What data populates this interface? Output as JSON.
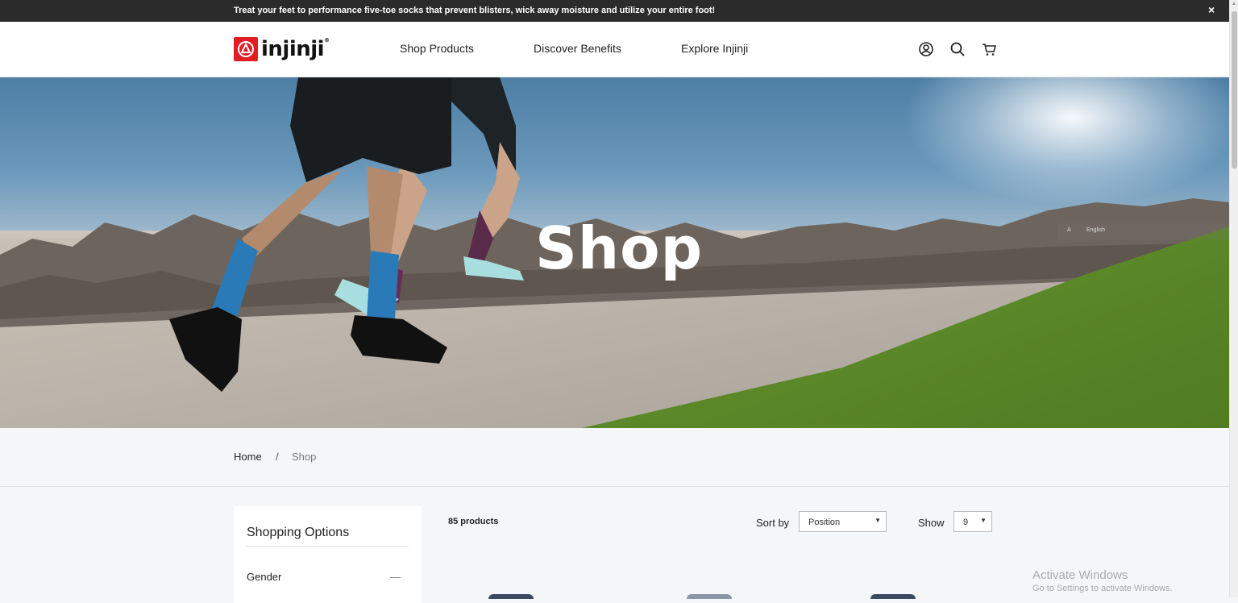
{
  "announcement": {
    "text": "Treat your feet to performance five-toe socks that prevent blisters, wick away moisture and utilize your entire foot!",
    "close": "×"
  },
  "header": {
    "logo": {
      "word": "injinji",
      "mark": "®"
    },
    "nav": [
      {
        "label": "Shop Products"
      },
      {
        "label": "Discover Benefits"
      },
      {
        "label": "Explore Injinji"
      }
    ],
    "icons": [
      "account-icon",
      "search-icon",
      "cart-icon"
    ]
  },
  "hero": {
    "title": "Shop",
    "translate_language": "English"
  },
  "breadcrumb": {
    "home": "Home",
    "separator": "/",
    "current": "Shop"
  },
  "sidebar": {
    "title": "Shopping Options",
    "filters": [
      {
        "label": "Gender",
        "toggle": "—"
      }
    ]
  },
  "toolbar": {
    "count": "85 products",
    "sort_label": "Sort by",
    "sort_value": "Position",
    "show_label": "Show",
    "show_value": "9"
  },
  "watermark": {
    "line1": "Activate Windows",
    "line2": "Go to Settings to activate Windows."
  },
  "colors": {
    "brand_red": "#e31b23",
    "announce_bg": "#2b2b2b",
    "page_bg": "#f5f6f8"
  }
}
